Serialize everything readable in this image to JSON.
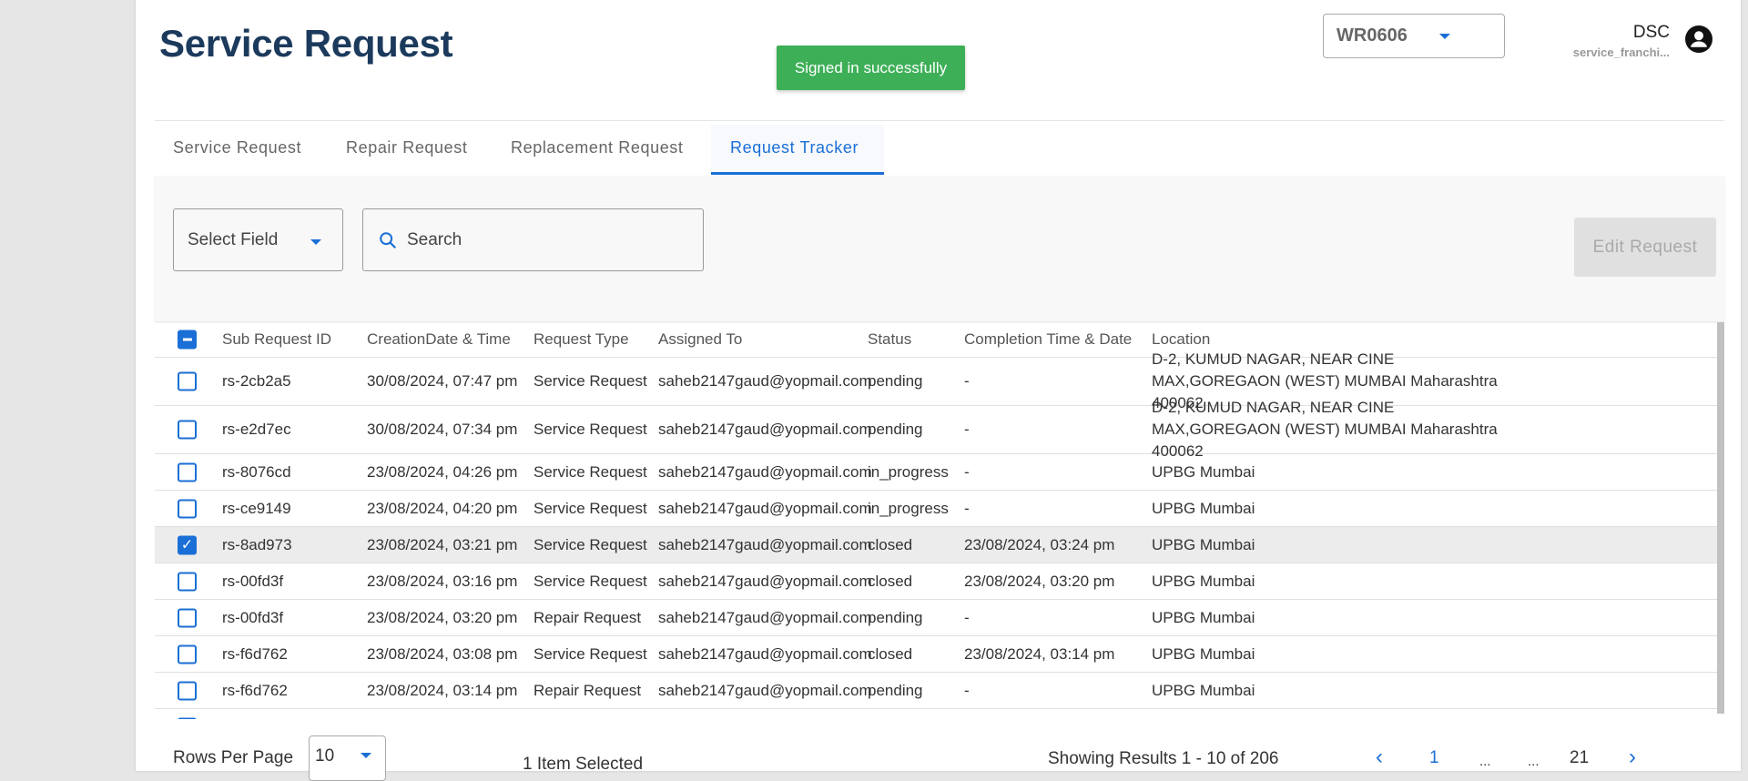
{
  "header": {
    "title": "Service Request",
    "toast": "Signed in successfully",
    "warehouse": "WR0606",
    "user_name": "DSC",
    "user_role": "service_franchi..."
  },
  "tabs": [
    "Service Request",
    "Repair Request",
    "Replacement Request",
    "Request Tracker"
  ],
  "filters": {
    "select_field": "Select Field",
    "search_placeholder": "Search",
    "edit_button": "Edit Request"
  },
  "table": {
    "columns": [
      "Sub Request ID",
      "CreationDate & Time",
      "Request Type",
      "Assigned To",
      "Status",
      "Completion Time & Date",
      "Location"
    ],
    "rows": [
      [
        "rs-2cb2a5",
        "30/08/2024, 07:47 pm",
        "Service Request",
        "saheb2147gaud@yopmail.com",
        "pending",
        "-",
        "D-2, KUMUD NAGAR, NEAR CINE MAX,GOREGAON (WEST) MUMBAI Maharashtra 400062"
      ],
      [
        "rs-e2d7ec",
        "30/08/2024, 07:34 pm",
        "Service Request",
        "saheb2147gaud@yopmail.com",
        "pending",
        "-",
        "D-2, KUMUD NAGAR, NEAR CINE MAX,GOREGAON (WEST) MUMBAI Maharashtra 400062"
      ],
      [
        "rs-8076cd",
        "23/08/2024, 04:26 pm",
        "Service Request",
        "saheb2147gaud@yopmail.com",
        "in_progress",
        "-",
        "UPBG Mumbai"
      ],
      [
        "rs-ce9149",
        "23/08/2024, 04:20 pm",
        "Service Request",
        "saheb2147gaud@yopmail.com",
        "in_progress",
        "-",
        "UPBG Mumbai"
      ],
      [
        "rs-8ad973",
        "23/08/2024, 03:21 pm",
        "Service Request",
        "saheb2147gaud@yopmail.com",
        "closed",
        "23/08/2024, 03:24 pm",
        "UPBG Mumbai"
      ],
      [
        "rs-00fd3f",
        "23/08/2024, 03:16 pm",
        "Service Request",
        "saheb2147gaud@yopmail.com",
        "closed",
        "23/08/2024, 03:20 pm",
        "UPBG Mumbai"
      ],
      [
        "rs-00fd3f",
        "23/08/2024, 03:20 pm",
        "Repair Request",
        "saheb2147gaud@yopmail.com",
        "pending",
        "-",
        "UPBG Mumbai"
      ],
      [
        "rs-f6d762",
        "23/08/2024, 03:08 pm",
        "Service Request",
        "saheb2147gaud@yopmail.com",
        "closed",
        "23/08/2024, 03:14 pm",
        "UPBG Mumbai"
      ],
      [
        "rs-f6d762",
        "23/08/2024, 03:14 pm",
        "Repair Request",
        "saheb2147gaud@yopmail.com",
        "pending",
        "-",
        "UPBG Mumbai"
      ]
    ],
    "selected_row": 4
  },
  "footer": {
    "rows_per_page_label": "Rows Per Page",
    "rows_per_page": "10",
    "selected_count": "1 Item Selected",
    "showing": "Showing Results 1 - 10 of 206",
    "pages": [
      "1",
      "...",
      "...",
      "21"
    ]
  }
}
